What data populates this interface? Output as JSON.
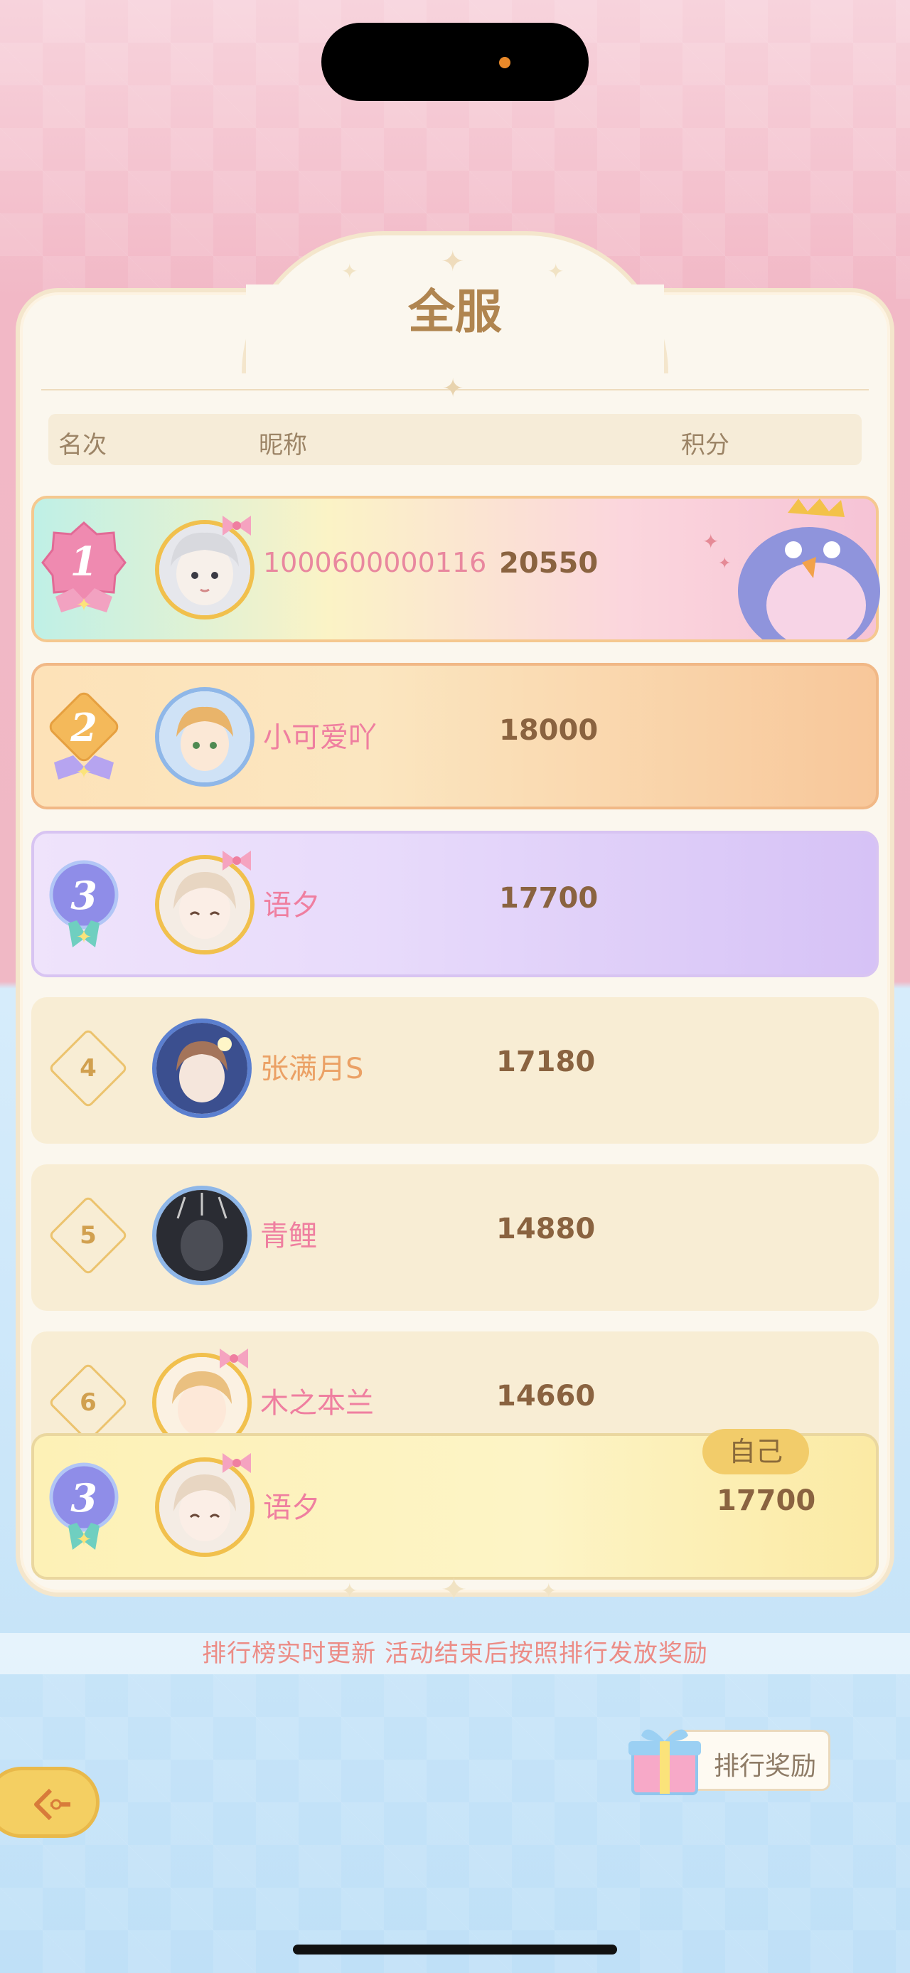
{
  "header": {
    "title": "全服"
  },
  "columns": {
    "rank": "名次",
    "nickname": "昵称",
    "score": "积分"
  },
  "rows": [
    {
      "rank": "1",
      "nickname": "1000600000116",
      "score": "20550"
    },
    {
      "rank": "2",
      "nickname": "小可爱吖",
      "score": "18000"
    },
    {
      "rank": "3",
      "nickname": "语夕",
      "score": "17700"
    },
    {
      "rank": "4",
      "nickname": "张满月S",
      "score": "17180"
    },
    {
      "rank": "5",
      "nickname": "青鲤",
      "score": "14880"
    },
    {
      "rank": "6",
      "nickname": "木之本兰",
      "score": "14660"
    }
  ],
  "self": {
    "tag": "自己",
    "rank": "3",
    "nickname": "语夕",
    "score": "17700"
  },
  "notice": "排行榜实时更新 活动结束后按照排行发放奖励",
  "reward_button": {
    "label": "排行奖励",
    "icon": "gift-box-icon"
  },
  "back_button": {
    "icon": "back-arrow-icon"
  },
  "colors": {
    "accent": "#f2cc6a",
    "nickname": "#ef7fa0",
    "score": "#8a6340",
    "title": "#b08550"
  }
}
